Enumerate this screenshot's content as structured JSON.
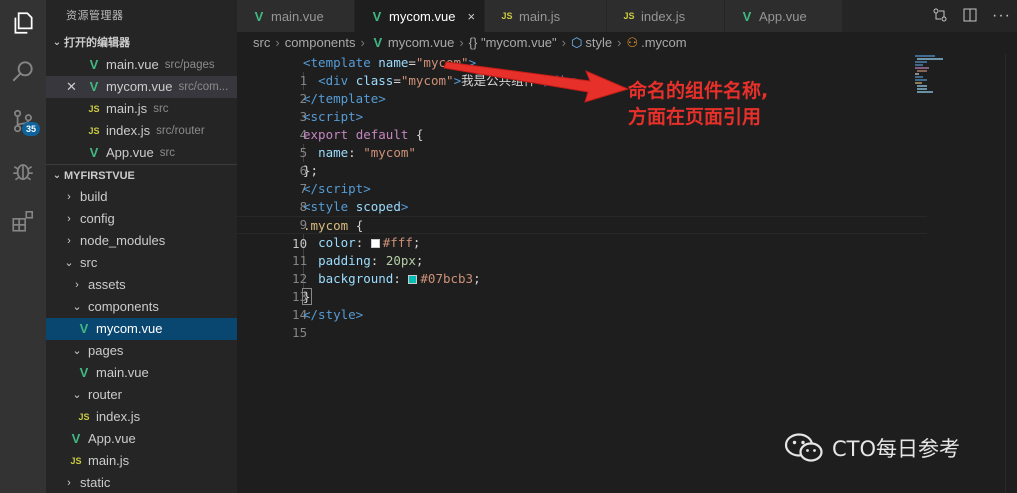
{
  "activity_bar": {
    "icons": [
      "files-icon",
      "search-icon",
      "source-control-icon",
      "debug-icon",
      "extensions-icon"
    ],
    "scm_badge": "35"
  },
  "sidebar": {
    "title": "资源管理器",
    "open_editors": {
      "header": "打开的编辑器",
      "items": [
        {
          "name": "main.vue",
          "desc": "src/pages",
          "type": "vue"
        },
        {
          "name": "mycom.vue",
          "desc": "src/com...",
          "type": "vue"
        },
        {
          "name": "main.js",
          "desc": "src",
          "type": "js"
        },
        {
          "name": "index.js",
          "desc": "src/router",
          "type": "js"
        },
        {
          "name": "App.vue",
          "desc": "src",
          "type": "vue"
        }
      ]
    },
    "project": {
      "header": "MYFIRSTVUE",
      "items": [
        {
          "name": "build",
          "type": "folder",
          "open": false
        },
        {
          "name": "config",
          "type": "folder",
          "open": false
        },
        {
          "name": "node_modules",
          "type": "folder",
          "open": false
        },
        {
          "name": "src",
          "type": "folder",
          "open": true
        },
        {
          "name": "assets",
          "type": "folder",
          "open": false
        },
        {
          "name": "components",
          "type": "folder",
          "open": true
        },
        {
          "name": "mycom.vue",
          "type": "vue"
        },
        {
          "name": "pages",
          "type": "folder",
          "open": true
        },
        {
          "name": "main.vue",
          "type": "vue"
        },
        {
          "name": "router",
          "type": "folder",
          "open": true
        },
        {
          "name": "index.js",
          "type": "js"
        },
        {
          "name": "App.vue",
          "type": "vue"
        },
        {
          "name": "main.js",
          "type": "js"
        },
        {
          "name": "static",
          "type": "folder",
          "open": false
        }
      ]
    }
  },
  "tabs": [
    {
      "label": "main.vue",
      "type": "vue"
    },
    {
      "label": "mycom.vue",
      "type": "vue",
      "close": "×"
    },
    {
      "label": "main.js",
      "type": "js"
    },
    {
      "label": "index.js",
      "type": "js"
    },
    {
      "label": "App.vue",
      "type": "vue"
    }
  ],
  "breadcrumb": {
    "src": "src",
    "components": "components",
    "file": "mycom.vue",
    "object": "{} \"mycom.vue\"",
    "style": "style",
    "selector": ".mycom"
  },
  "editor": {
    "line_numbers": [
      "1",
      "2",
      "3",
      "4",
      "5",
      "6",
      "7",
      "8",
      "9",
      "10",
      "11",
      "12",
      "13",
      "14",
      "15"
    ],
    "current_line": "10",
    "swatch_white": "#ffffff",
    "swatch_teal": "#07bcb3"
  },
  "annotation": {
    "line1": "命名的组件名称,",
    "line2": "方面在页面引用"
  },
  "watermark": "CTO每日参考",
  "colors": {
    "vue": "#41b883",
    "js": "#cbcb41",
    "annotation": "#e8302a",
    "accent": "#0e639c"
  }
}
